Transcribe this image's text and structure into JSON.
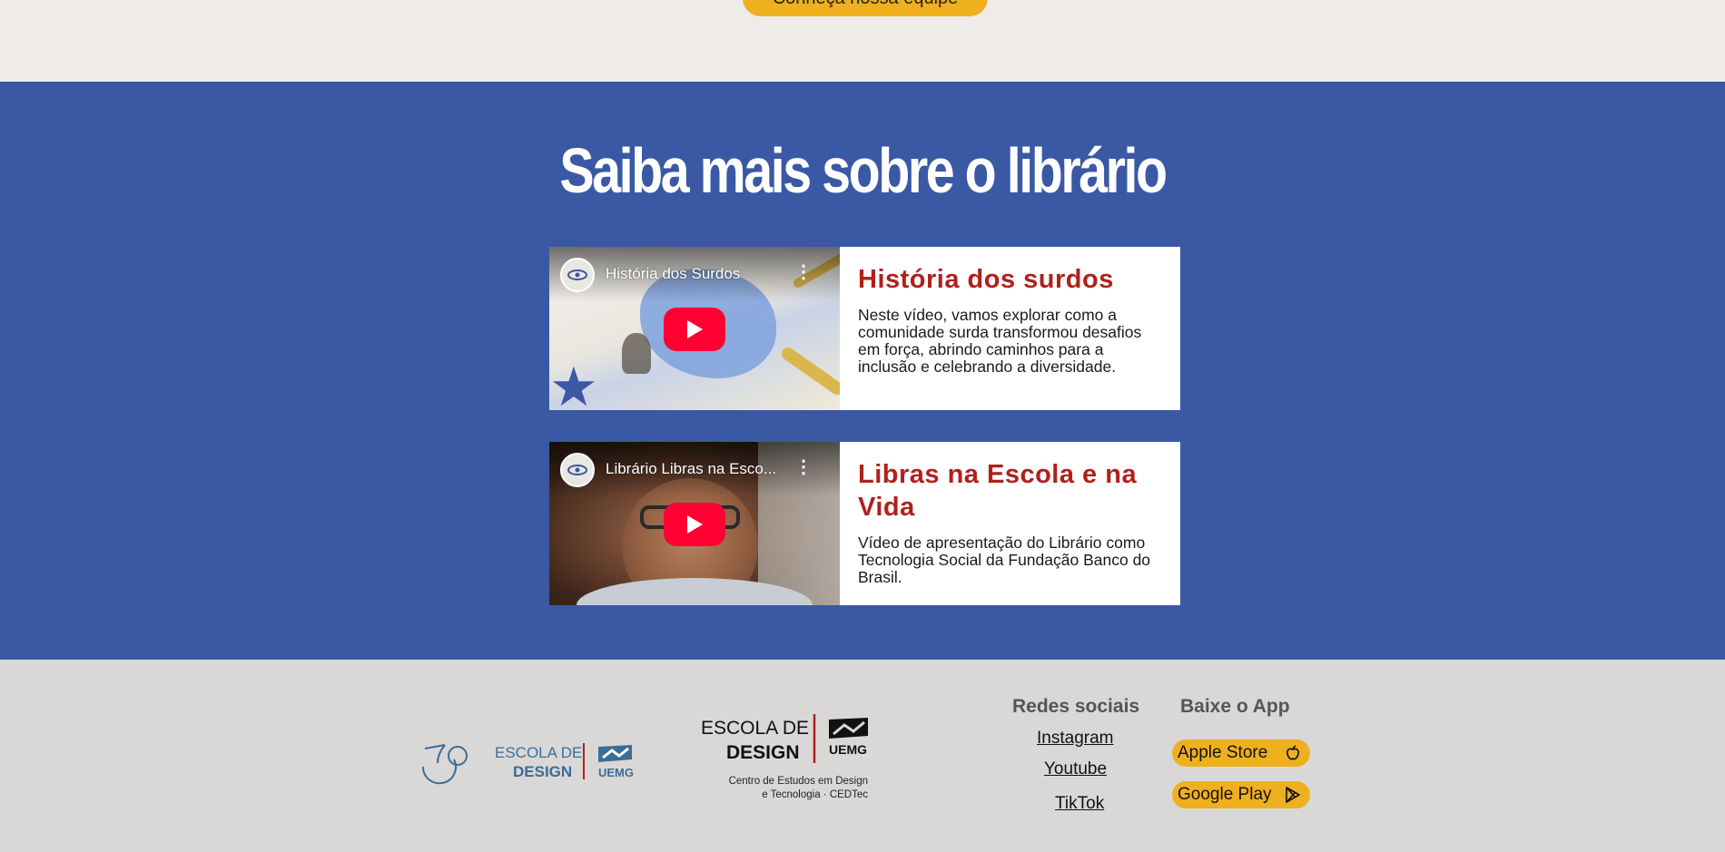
{
  "header": {
    "team_button": "Conheça nossa equipe"
  },
  "section": {
    "title": "Saiba mais sobre o librário",
    "cards": [
      {
        "video_title": "História dos Surdos",
        "heading": "História dos surdos",
        "description": "Neste vídeo, vamos explorar como a comunidade surda transformou desafios em força, abrindo caminhos para a inclusão e celebrando a diversidade."
      },
      {
        "video_title": "Librário Libras na Esco...",
        "heading": "Libras na Escola e na Vida",
        "description": "Vídeo de apresentação do Librário como Tecnologia Social da Fundação Banco do Brasil."
      }
    ]
  },
  "footer": {
    "logo1": {
      "line1": "ESCOLA DE",
      "line2": "DESIGN",
      "org": "UEMG"
    },
    "logo2": {
      "line1": "ESCOLA DE",
      "line2": "DESIGN",
      "org": "UEMG",
      "sub1": "Centro de Estudos em Design",
      "sub2": "e Tecnologia · CEDTec"
    },
    "social_title": "Redes sociais",
    "social_links": [
      "Instagram",
      "Youtube",
      "TikTok"
    ],
    "app_title": "Baixe o App",
    "app_buttons": [
      "Apple Store",
      "Google Play"
    ]
  },
  "colors": {
    "blue": "#3a58a4",
    "accent_yellow": "#efb01f",
    "heading_red": "#b0201c",
    "footer_bg": "#d9d8d7",
    "youtube_red": "#ff0033"
  },
  "icons": [
    "channel-logo-icon",
    "more-vert-icon",
    "play-icon",
    "apple-icon",
    "google-play-icon"
  ]
}
